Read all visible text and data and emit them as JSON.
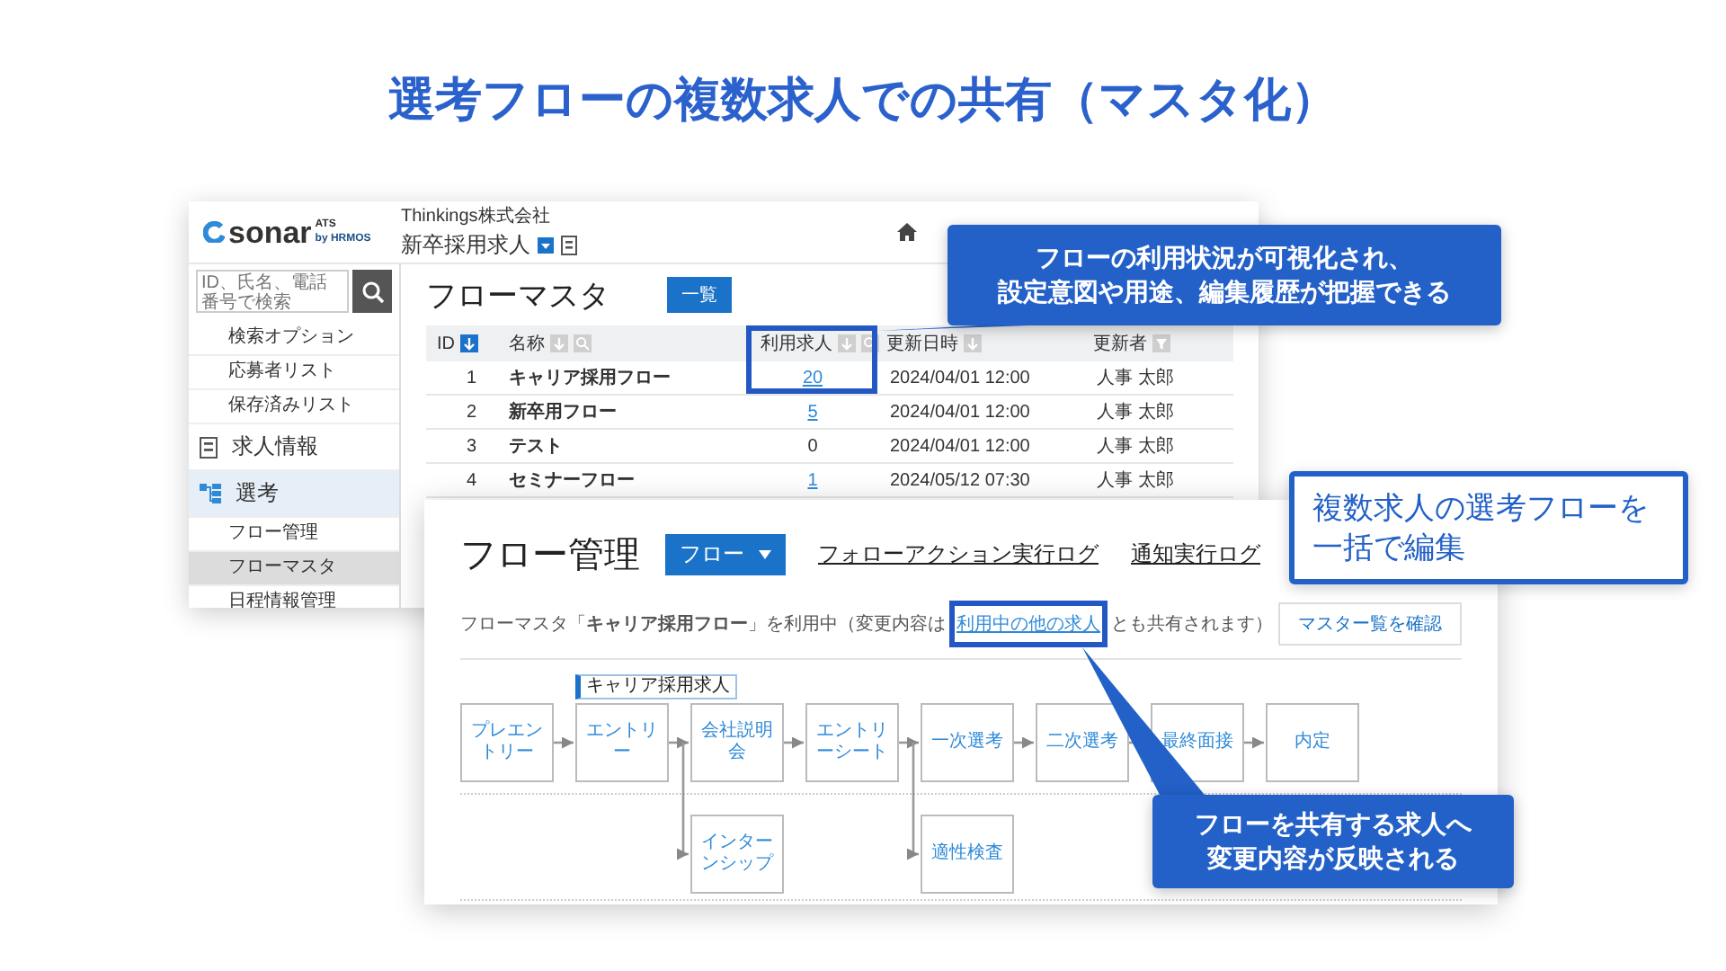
{
  "title": "選考フローの複数求人での共有（マスタ化）",
  "master_window": {
    "logo": {
      "brand": "sonar",
      "suffix": "ATS",
      "by": "by HRMOS"
    },
    "company": "Thinkings株式会社",
    "job": "新卒採用求人",
    "search": {
      "placeholder": "ID、氏名、電話番号で検索"
    },
    "sidebar": [
      {
        "label": "検索オプション",
        "kind": "sub",
        "selected": false
      },
      {
        "label": "応募者リスト",
        "kind": "sub",
        "selected": false
      },
      {
        "label": "保存済みリスト",
        "kind": "sub",
        "selected": false
      },
      {
        "label": "求人情報",
        "kind": "section",
        "selected": false
      },
      {
        "label": "選考",
        "kind": "section",
        "selected": true
      },
      {
        "label": "フロー管理",
        "kind": "sub",
        "selected": false
      },
      {
        "label": "フローマスタ",
        "kind": "sub",
        "selected": true
      },
      {
        "label": "日程情報管理",
        "kind": "sub",
        "selected": false
      }
    ],
    "heading": "フローマスタ",
    "view_button": "一覧",
    "columns": [
      {
        "label": "ID",
        "sort_active": true
      },
      {
        "label": "名称",
        "sort_active": false
      },
      {
        "label": "利用求人",
        "sort_active": false
      },
      {
        "label": "更新日時",
        "sort_active": false
      },
      {
        "label": "更新者"
      }
    ],
    "rows": [
      {
        "id": "1",
        "name": "キャリア採用フロー",
        "usage": "20",
        "usage_link": true,
        "updated": "2024/04/01 12:00",
        "updater": "人事 太郎"
      },
      {
        "id": "2",
        "name": "新卒用フロー",
        "usage": "5",
        "usage_link": true,
        "updated": "2024/04/01 12:00",
        "updater": "人事 太郎"
      },
      {
        "id": "3",
        "name": "テスト",
        "usage": "0",
        "usage_link": false,
        "updated": "2024/04/01 12:00",
        "updater": "人事 太郎"
      },
      {
        "id": "4",
        "name": "セミナーフロー",
        "usage": "1",
        "usage_link": true,
        "updated": "2024/05/12 07:30",
        "updater": "人事 太郎"
      }
    ]
  },
  "flow_window": {
    "heading": "フロー管理",
    "dropdown": "フロー",
    "links": [
      "フォローアクション実行ログ",
      "通知実行ログ"
    ],
    "notice": {
      "before": "フローマスタ「**キャリア採用フロー**」を利用中（変更内容は",
      "link": "利用中の他の求人",
      "after": "とも共有されます）"
    },
    "master_button": "マスター覧を確認",
    "nodes": [
      {
        "label": "プレエントリー"
      },
      {
        "label": "エントリー",
        "tag": "キャリア採用求人",
        "branch": "インターンシップ"
      },
      {
        "label": "会社説明会"
      },
      {
        "label": "エントリーシート",
        "branch": "適性検査"
      },
      {
        "label": "一次選考"
      },
      {
        "label": "二次選考"
      },
      {
        "label": "最終面接"
      },
      {
        "label": "内定"
      }
    ]
  },
  "callouts": [
    {
      "lines": [
        "フローの利用状況が可視化され、",
        "設定意図や用途、編集履歴が把握できる"
      ],
      "kind": "filled",
      "pointer": true
    },
    {
      "lines": [
        "複数求人の選考フローを",
        "一括で編集"
      ],
      "kind": "outlined",
      "pointer": false
    },
    {
      "lines": [
        "フローを共有する求人へ",
        "変更内容が反映される"
      ],
      "kind": "filled",
      "pointer": true
    }
  ]
}
